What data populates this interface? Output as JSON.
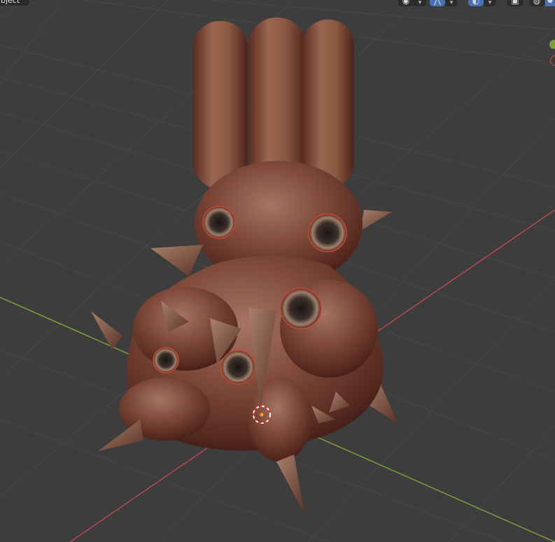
{
  "header": {
    "mode_label": "bject"
  },
  "toolbar": {
    "view_icon": "eye-icon",
    "gizmo_icon": "move-gizmo-icon",
    "overlay_icon": "overlay-icon",
    "xray_icon": "xray-icon",
    "shading_icon": "wireframe-sphere-icon"
  },
  "colors": {
    "background": "#3d3d3d",
    "grid_line": "#474747",
    "x_axis": "#b8494f",
    "y_axis": "#7ca03a",
    "active_button": "#4772b3",
    "header_button": "#2b2b2b"
  }
}
